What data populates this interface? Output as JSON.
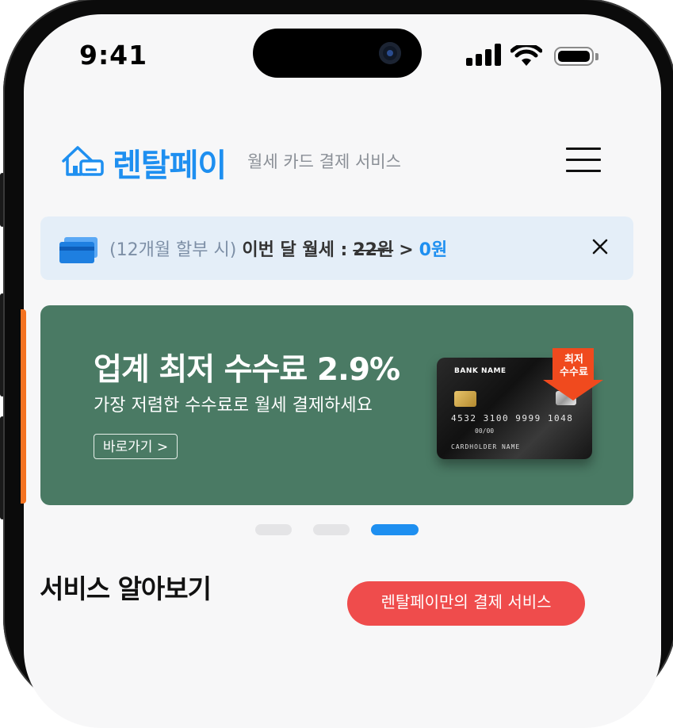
{
  "status_bar": {
    "time": "9:41"
  },
  "header": {
    "brand": "렌탈페이",
    "tagline": "월세 카드 결제 서비스",
    "icons": {
      "logo": "house-card-icon",
      "menu": "hamburger-menu-icon"
    }
  },
  "notice": {
    "prefix": "(12개월 할부 시)",
    "label": "이번 달 월세 :",
    "old_price": "22원",
    "arrow": ">",
    "new_price": "0원",
    "icons": {
      "card": "credit-card-icon",
      "close": "close-icon"
    }
  },
  "banner": {
    "title": "업계 최저 수수료 2.9%",
    "subtitle": "가장 저렴한 수수료로 월세 결제하세요",
    "button_label": "바로가기 >",
    "badge_line1": "최저",
    "badge_line2": "수수료",
    "card": {
      "bank_name": "BANK NAME",
      "number": "4532 3100 9999 1048",
      "expiry": "00/00",
      "holder": "CARDHOLDER NAME"
    },
    "background_color": "#4a7a64",
    "accent_color": "#f47321"
  },
  "carousel": {
    "total": 3,
    "active_index": 2
  },
  "section": {
    "title": "서비스 알아보기",
    "pill_label": "렌탈페이만의 결제 서비스"
  },
  "colors": {
    "brand": "#1e8ff0",
    "pill": "#ef4c4c",
    "notice_bg": "#e4eef8"
  }
}
